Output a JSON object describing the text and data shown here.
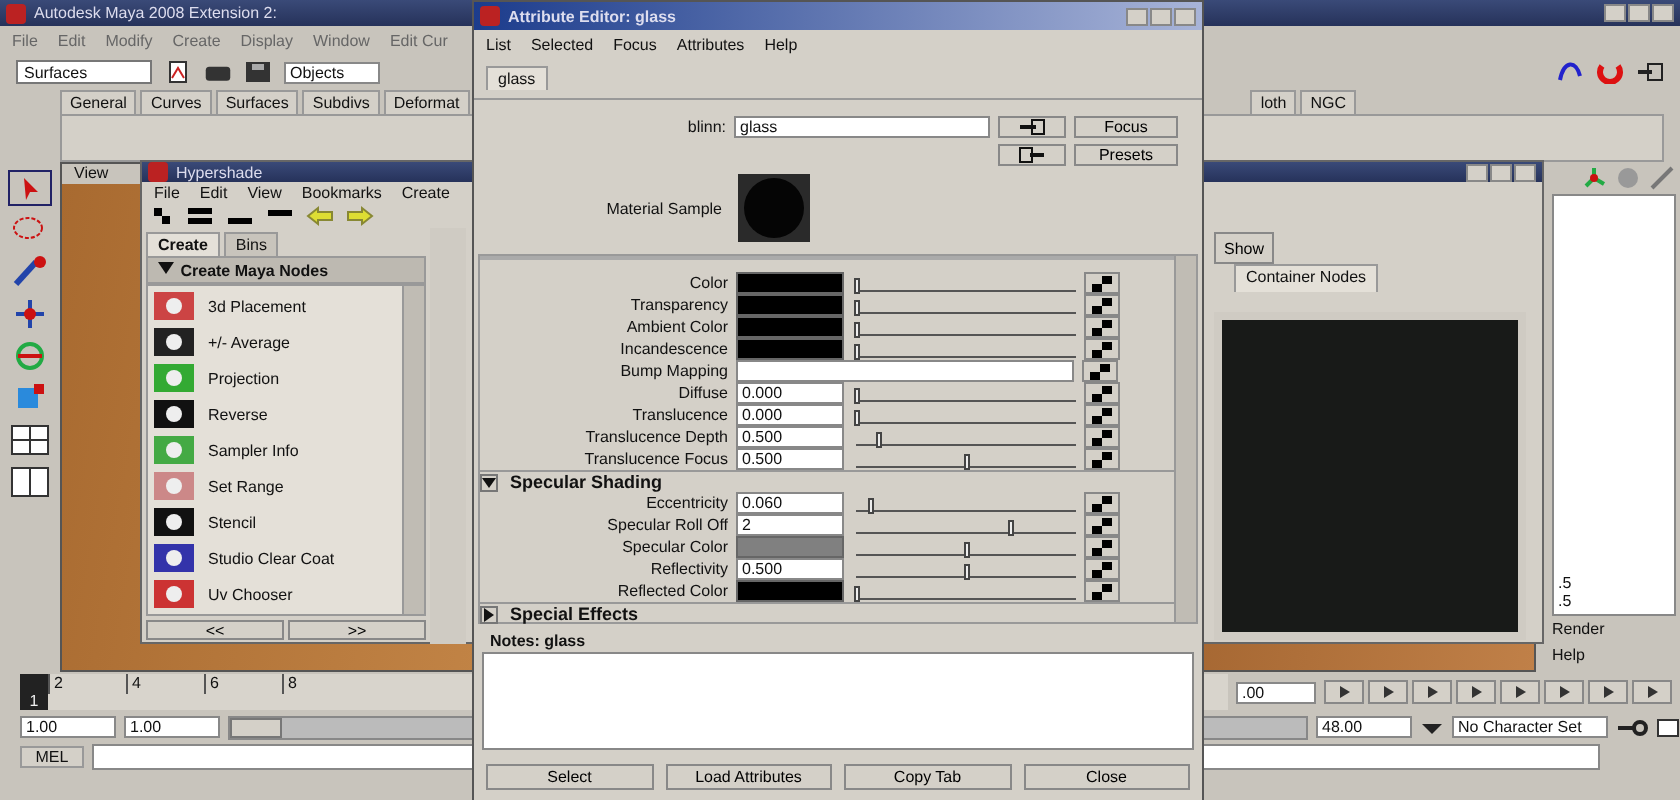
{
  "main_window": {
    "title": "Autodesk Maya 2008 Extension 2:",
    "menus": [
      "File",
      "Edit",
      "Modify",
      "Create",
      "Display",
      "Window",
      "Edit Cur"
    ],
    "menu_set": "Surfaces",
    "selection_mode": "Objects",
    "shelf_tabs": [
      "General",
      "Curves",
      "Surfaces",
      "Subdivs",
      "Deformat"
    ],
    "shelf_tabs_right": [
      "loth",
      "NGC"
    ],
    "viewport_menus": [
      "View"
    ],
    "channel_box": {
      "values": [
        ".5",
        ".5"
      ],
      "menus": [
        "Render",
        "Help"
      ]
    },
    "timeline": {
      "current_frame": "1",
      "level": 0,
      "ticks": [
        "2",
        "4",
        "6",
        "8"
      ],
      "end_field": ".00"
    },
    "range": {
      "level": 0,
      "start_time": "1.00",
      "playback_start": "1.00",
      "playback_end": "48.00"
    },
    "character_set": "No Character Set",
    "command_line": {
      "label": "MEL"
    }
  },
  "hypershade": {
    "title": "Hypershade",
    "menus": [
      "File",
      "Edit",
      "View",
      "Bookmarks",
      "Create"
    ],
    "tabs": [
      {
        "label": "Create",
        "selected": true
      },
      {
        "label": "Bins",
        "selected": false
      }
    ],
    "section": "Create Maya Nodes",
    "nodes": [
      "3d Placement",
      "+/- Average",
      "Projection",
      "Reverse",
      "Sampler Info",
      "Set Range",
      "Stencil",
      "Studio Clear Coat",
      "Uv Chooser"
    ],
    "nav": [
      "<<",
      ">>"
    ],
    "show_button": "Show",
    "work_tabs": [
      {
        "label": "Container Nodes",
        "selected": true
      }
    ]
  },
  "attribute_editor": {
    "title": "Attribute Editor: glass",
    "menus": [
      "List",
      "Selected",
      "Focus",
      "Attributes",
      "Help"
    ],
    "tabs": [
      {
        "label": "glass",
        "selected": true
      }
    ],
    "node_type": "blinn:",
    "node_name": "glass",
    "buttons_side": [
      "Focus",
      "Presets"
    ],
    "sample_label": "Material Sample",
    "rows": [
      {
        "label": "Color",
        "kind": "color",
        "color": "#000000",
        "level": 0
      },
      {
        "label": "Transparency",
        "kind": "color",
        "color": "#000000",
        "level": 0
      },
      {
        "label": "Ambient Color",
        "kind": "color",
        "color": "#000000",
        "level": 0
      },
      {
        "label": "Incandescence",
        "kind": "color",
        "color": "#000000",
        "level": 0
      },
      {
        "label": "Bump Mapping",
        "kind": "map"
      },
      {
        "label": "Diffuse",
        "kind": "number",
        "value": "0.000",
        "level": 0
      },
      {
        "label": "Translucence",
        "kind": "number",
        "value": "0.000",
        "level": 0
      },
      {
        "label": "Translucence Depth",
        "kind": "number",
        "value": "0.500",
        "level": 0.1
      },
      {
        "label": "Translucence Focus",
        "kind": "number",
        "value": "0.500",
        "level": 0.5
      }
    ],
    "sections": [
      {
        "title": "Specular Shading",
        "expanded": true,
        "rows": [
          {
            "label": "Eccentricity",
            "kind": "number",
            "value": "0.060",
            "level": 0.06
          },
          {
            "label": "Specular Roll Off",
            "kind": "number",
            "value": "2",
            "level": 0.7
          },
          {
            "label": "Specular Color",
            "kind": "color",
            "color": "#808080",
            "level": 0.5
          },
          {
            "label": "Reflectivity",
            "kind": "number",
            "value": "0.500",
            "level": 0.5
          },
          {
            "label": "Reflected Color",
            "kind": "color",
            "color": "#000000",
            "level": 0
          }
        ]
      },
      {
        "title": "Special Effects",
        "expanded": false
      }
    ],
    "notes_label": "Notes:  glass",
    "buttons": [
      "Select",
      "Load Attributes",
      "Copy Tab",
      "Close"
    ]
  }
}
